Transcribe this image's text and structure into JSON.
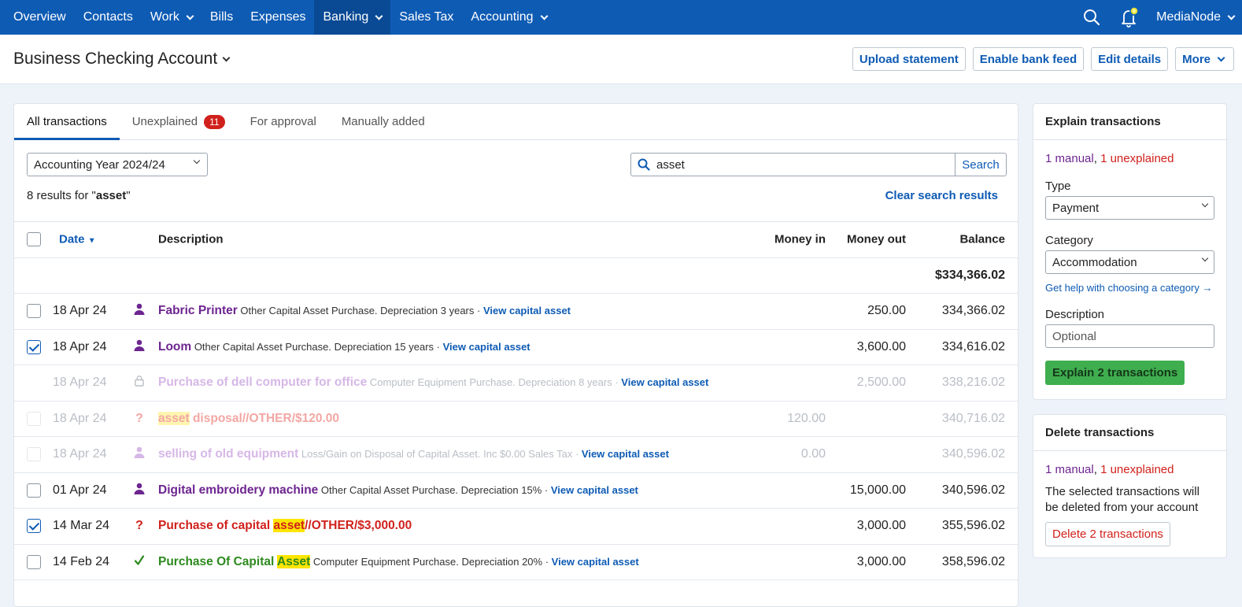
{
  "nav": {
    "items": [
      {
        "label": "Overview",
        "dropdown": false,
        "active": false
      },
      {
        "label": "Contacts",
        "dropdown": false,
        "active": false
      },
      {
        "label": "Work",
        "dropdown": true,
        "active": false
      },
      {
        "label": "Bills",
        "dropdown": false,
        "active": false
      },
      {
        "label": "Expenses",
        "dropdown": false,
        "active": false
      },
      {
        "label": "Banking",
        "dropdown": true,
        "active": true
      },
      {
        "label": "Sales Tax",
        "dropdown": false,
        "active": false
      },
      {
        "label": "Accounting",
        "dropdown": true,
        "active": false
      }
    ],
    "org_name": "MediaNode",
    "icons": [
      "search-icon",
      "bell-icon"
    ]
  },
  "header": {
    "title": "Business Checking Account",
    "actions": {
      "upload": "Upload statement",
      "bankfeed": "Enable bank feed",
      "edit": "Edit details",
      "more": "More"
    }
  },
  "tabs": {
    "all": "All transactions",
    "unexplained": "Unexplained",
    "unexplained_count": "11",
    "approval": "For approval",
    "manual": "Manually added"
  },
  "filters": {
    "year": "Accounting Year 2024/24",
    "search_value": "asset",
    "search_button": "Search",
    "results_prefix": "8 results for \"",
    "results_term": "asset",
    "results_suffix": "\"",
    "clear": "Clear search results"
  },
  "table": {
    "headers": {
      "date": "Date",
      "description": "Description",
      "money_in": "Money in",
      "money_out": "Money out",
      "balance": "Balance"
    },
    "opening_balance": "$334,366.02",
    "rows": [
      {
        "checkbox": "unchecked",
        "date": "18 Apr 24",
        "icon": "person-icon",
        "status": "normal",
        "title": "Fabric Printer",
        "title_hl": "",
        "title_rest": "",
        "detail": "Other Capital Asset Purchase. Depreciation 3 years ·",
        "link": "View capital asset",
        "money_in": "",
        "money_out": "250.00",
        "balance": "334,366.02"
      },
      {
        "checkbox": "checked",
        "date": "18 Apr 24",
        "icon": "person-icon",
        "status": "normal",
        "title": "Loom",
        "title_hl": "",
        "title_rest": "",
        "detail": "Other Capital Asset Purchase. Depreciation 15 years ·",
        "link": "View capital asset",
        "money_in": "",
        "money_out": "3,600.00",
        "balance": "334,616.02"
      },
      {
        "checkbox": "none",
        "date": "18 Apr 24",
        "icon": "lock-icon",
        "status": "locked",
        "title": "Purchase of dell computer for office",
        "title_hl": "",
        "title_rest": "",
        "detail": "Computer Equipment Purchase. Depreciation 8 years ·",
        "link": "View capital asset",
        "money_in": "",
        "money_out": "2,500.00",
        "balance": "338,216.02"
      },
      {
        "checkbox": "disabled",
        "date": "18 Apr 24",
        "icon": "question-icon",
        "status": "faded-unexplained",
        "title": "",
        "title_hl": "asset",
        "title_rest": " disposal//OTHER/$120.00",
        "detail": "",
        "link": "",
        "money_in": "120.00",
        "money_out": "",
        "balance": "340,716.02"
      },
      {
        "checkbox": "disabled",
        "date": "18 Apr 24",
        "icon": "person-icon",
        "status": "faded-manual",
        "title": "selling of old equipment",
        "title_hl": "",
        "title_rest": "",
        "detail": "Loss/Gain on Disposal of Capital Asset. Inc $0.00 Sales Tax ·",
        "link": "View capital asset",
        "money_in": "0.00",
        "money_out": "",
        "balance": "340,596.02"
      },
      {
        "checkbox": "unchecked",
        "date": "01 Apr 24",
        "icon": "person-icon",
        "status": "normal",
        "title": "Digital embroidery machine",
        "title_hl": "",
        "title_rest": "",
        "detail": "Other Capital Asset Purchase. Depreciation 15% ·",
        "link": "View capital asset",
        "money_in": "",
        "money_out": "15,000.00",
        "balance": "340,596.02"
      },
      {
        "checkbox": "checked",
        "date": "14 Mar 24",
        "icon": "question-icon",
        "status": "unexplained",
        "title": "Purchase of capital ",
        "title_hl": "asset",
        "title_rest": "//OTHER/$3,000.00",
        "detail": "",
        "link": "",
        "money_in": "",
        "money_out": "3,000.00",
        "balance": "355,596.02"
      },
      {
        "checkbox": "unchecked",
        "date": "14 Feb 24",
        "icon": "check-icon",
        "status": "explained",
        "title": "Purchase Of Capital ",
        "title_hl": "Asset",
        "title_rest": "",
        "detail": "Computer Equipment Purchase. Depreciation 20% ·",
        "link": "View capital asset",
        "money_in": "",
        "money_out": "3,000.00",
        "balance": "358,596.02"
      }
    ]
  },
  "explain": {
    "title": "Explain transactions",
    "count_manual": "1 manual",
    "count_unexplained": "1 unexplained",
    "type_label": "Type",
    "type_value": "Payment",
    "category_label": "Category",
    "category_value": "Accommodation",
    "help": "Get help with choosing a category →",
    "description_label": "Description",
    "description_placeholder": "Optional",
    "button": "Explain 2 transactions"
  },
  "delete": {
    "title": "Delete transactions",
    "count_manual": "1 manual",
    "count_unexplained": "1 unexplained",
    "message": "The selected transactions will be deleted from your account",
    "button": "Delete 2 transactions"
  },
  "colors": {
    "nav_bg": "#0e5bb4",
    "accent": "#0e5bb4",
    "manual": "#6d2590",
    "unexplained": "#d0211c",
    "explained": "#2d8a1e",
    "primary_button": "#3fae4e",
    "highlight": "#ffe500"
  }
}
